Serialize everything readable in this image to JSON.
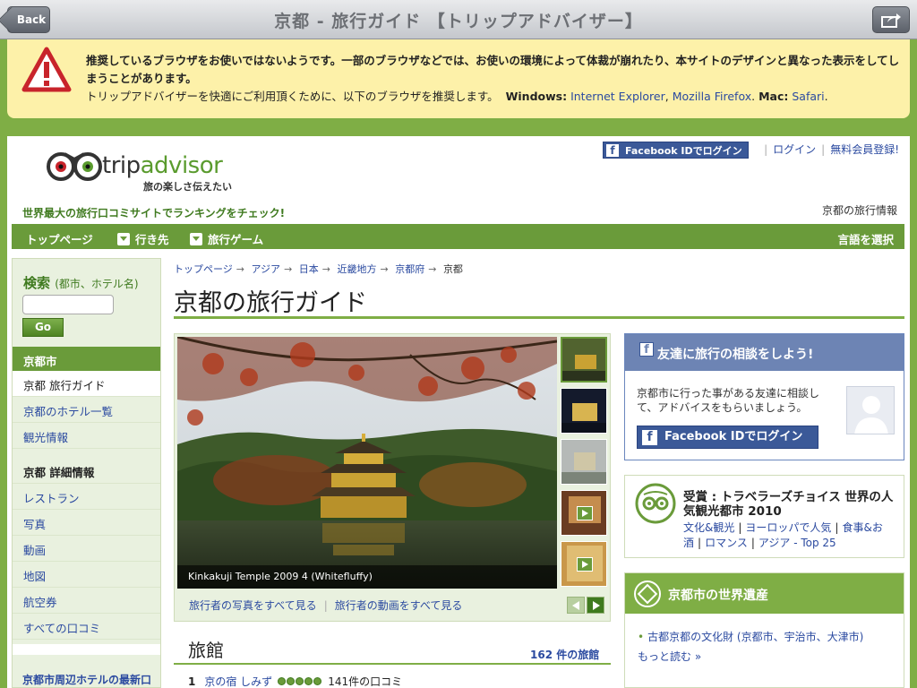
{
  "top_bar": {
    "back_label": "Back",
    "title": "京都 - 旅行ガイド 【トリップアドバイザー】"
  },
  "warning": {
    "line1": "推奨しているブラウザをお使いではないようです。一部のブラウザなどでは、お使いの環境によって体裁が崩れたり、本サイトのデザインと異なった表示をしてしまうことがあります。",
    "line2_prefix": "トリップアドバイザーを快適にご利用頂くために、以下のブラウザを推奨します。",
    "windows_label": "Windows:",
    "browser_ie": "Internet Explorer",
    "comma": ",",
    "browser_ff": "Mozilla Firefox",
    "period1": ".",
    "mac_label": "Mac:",
    "browser_safari": "Safari",
    "period2": "."
  },
  "header": {
    "logo_trip": "trip",
    "logo_advisor": "advisor",
    "logo_sub": "旅の楽しさ伝えたい",
    "fb_login_small": "Facebook IDでログイン",
    "login": "ログイン",
    "register": "無料会員登録!",
    "tagline": "世界最大の旅行口コミサイトでランキングをチェック!",
    "city_info": "京都の旅行情報"
  },
  "nav": {
    "home": "トップページ",
    "destinations": "行き先",
    "games": "旅行ゲーム",
    "language": "言語を選択"
  },
  "sidebar": {
    "search_label": "検索",
    "search_hint": "(都市、ホテル名)",
    "search_value": "",
    "go": "Go",
    "section_city": "京都市",
    "items_city": [
      {
        "label": "京都 旅行ガイド"
      },
      {
        "label": "京都のホテル一覧"
      },
      {
        "label": "観光情報"
      }
    ],
    "section_detail": "京都 詳細情報",
    "items_detail": [
      {
        "label": "レストラン"
      },
      {
        "label": "写真"
      },
      {
        "label": "動画"
      },
      {
        "label": "地図"
      },
      {
        "label": "航空券"
      },
      {
        "label": "すべての口コミ"
      }
    ],
    "bottom_text": "京都市周辺ホテルの最新口コミ情報"
  },
  "breadcrumb": [
    "トップページ",
    "アジア",
    "日本",
    "近畿地方",
    "京都府",
    "京都"
  ],
  "main": {
    "title": "京都の旅行ガイド",
    "photo_caption": "Kinkakuji Temple 2009 4 (Whitefluffy)",
    "link_photos": "旅行者の写真をすべて見る",
    "link_videos": "旅行者の動画をすべて見る",
    "ryokan_title": "旅館",
    "ryokan_count": "162 件の旅館",
    "ryokan_rows": [
      {
        "num": "1",
        "name": "京の宿 しみず",
        "rating": 5,
        "reviews": "141件の口コミ"
      }
    ]
  },
  "right": {
    "fb_box_title": "友達に旅行の相談をしよう!",
    "fb_box_text": "京都市に行った事がある友達に相談して、アドバイスをもらいましょう。",
    "fb_login_large": "Facebook IDでログイン",
    "award_title": "受賞 : トラベラーズチョイス 世界の人気観光都市 2010",
    "award_links": [
      "文化&観光",
      "ヨーロッパで人気",
      "食事&お酒",
      "ロマンス",
      "アジア - Top 25"
    ],
    "wh_title": "京都市の世界遺産",
    "wh_item": "古都京都の文化財 (京都市、宇治市、大津市)",
    "wh_more": "もっと読む »"
  },
  "colors": {
    "brand_green": "#6a9b3a",
    "link_blue": "#2b4aa0",
    "facebook_blue": "#3b5998",
    "warning_bg": "#fdf1a9"
  }
}
